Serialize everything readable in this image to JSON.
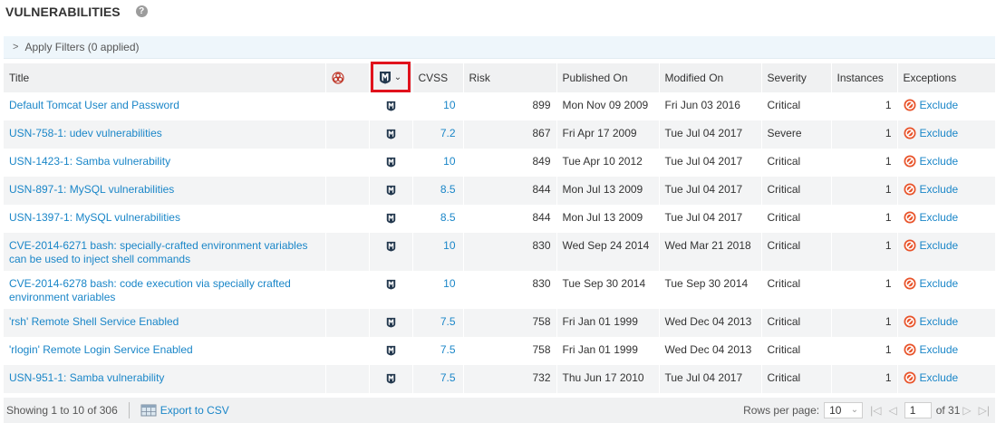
{
  "header": {
    "title": "VULNERABILITIES",
    "help_icon": "question-circle-icon"
  },
  "filters": {
    "label": "Apply Filters (0 applied)"
  },
  "columns": {
    "title": "Title",
    "malware": "biohazard-icon",
    "exploits": "metasploit-icon",
    "cvss": "CVSS",
    "risk": "Risk",
    "published": "Published On",
    "modified": "Modified On",
    "severity": "Severity",
    "instances": "Instances",
    "exceptions": "Exceptions"
  },
  "rows": [
    {
      "title": "Default Tomcat User and Password",
      "cvss": "10",
      "risk": "899",
      "published": "Mon Nov 09 2009",
      "modified": "Fri Jun 03 2016",
      "severity": "Critical",
      "instances": "1",
      "exception": "Exclude"
    },
    {
      "title": "USN-758-1: udev vulnerabilities",
      "cvss": "7.2",
      "risk": "867",
      "published": "Fri Apr 17 2009",
      "modified": "Tue Jul 04 2017",
      "severity": "Severe",
      "instances": "1",
      "exception": "Exclude"
    },
    {
      "title": "USN-1423-1: Samba vulnerability",
      "cvss": "10",
      "risk": "849",
      "published": "Tue Apr 10 2012",
      "modified": "Tue Jul 04 2017",
      "severity": "Critical",
      "instances": "1",
      "exception": "Exclude"
    },
    {
      "title": "USN-897-1: MySQL vulnerabilities",
      "cvss": "8.5",
      "risk": "844",
      "published": "Mon Jul 13 2009",
      "modified": "Tue Jul 04 2017",
      "severity": "Critical",
      "instances": "1",
      "exception": "Exclude"
    },
    {
      "title": "USN-1397-1: MySQL vulnerabilities",
      "cvss": "8.5",
      "risk": "844",
      "published": "Mon Jul 13 2009",
      "modified": "Tue Jul 04 2017",
      "severity": "Critical",
      "instances": "1",
      "exception": "Exclude"
    },
    {
      "title": "CVE-2014-6271 bash: specially-crafted environment variables can be used to inject shell commands",
      "cvss": "10",
      "risk": "830",
      "published": "Wed Sep 24 2014",
      "modified": "Wed Mar 21 2018",
      "severity": "Critical",
      "instances": "1",
      "exception": "Exclude"
    },
    {
      "title": "CVE-2014-6278 bash: code execution via specially crafted environment variables",
      "cvss": "10",
      "risk": "830",
      "published": "Tue Sep 30 2014",
      "modified": "Tue Sep 30 2014",
      "severity": "Critical",
      "instances": "1",
      "exception": "Exclude"
    },
    {
      "title": "'rsh' Remote Shell Service Enabled",
      "cvss": "7.5",
      "risk": "758",
      "published": "Fri Jan 01 1999",
      "modified": "Wed Dec 04 2013",
      "severity": "Critical",
      "instances": "1",
      "exception": "Exclude"
    },
    {
      "title": "'rlogin' Remote Login Service Enabled",
      "cvss": "7.5",
      "risk": "758",
      "published": "Fri Jan 01 1999",
      "modified": "Wed Dec 04 2013",
      "severity": "Critical",
      "instances": "1",
      "exception": "Exclude"
    },
    {
      "title": "USN-951-1: Samba vulnerability",
      "cvss": "7.5",
      "risk": "732",
      "published": "Thu Jun 17 2010",
      "modified": "Tue Jul 04 2017",
      "severity": "Critical",
      "instances": "1",
      "exception": "Exclude"
    }
  ],
  "footer": {
    "showing": "Showing 1 to 10 of 306",
    "export": "Export to CSV",
    "rows_per_page_label": "Rows per page:",
    "rows_per_page_value": "10",
    "page_value": "1",
    "of_pages": "of 31"
  },
  "colors": {
    "link": "#1a86c8",
    "highlight_box": "#e0121c",
    "header_bg": "#f0f1f2",
    "filter_bg": "#eef6fb",
    "exclude_icon": "#e8532a"
  }
}
